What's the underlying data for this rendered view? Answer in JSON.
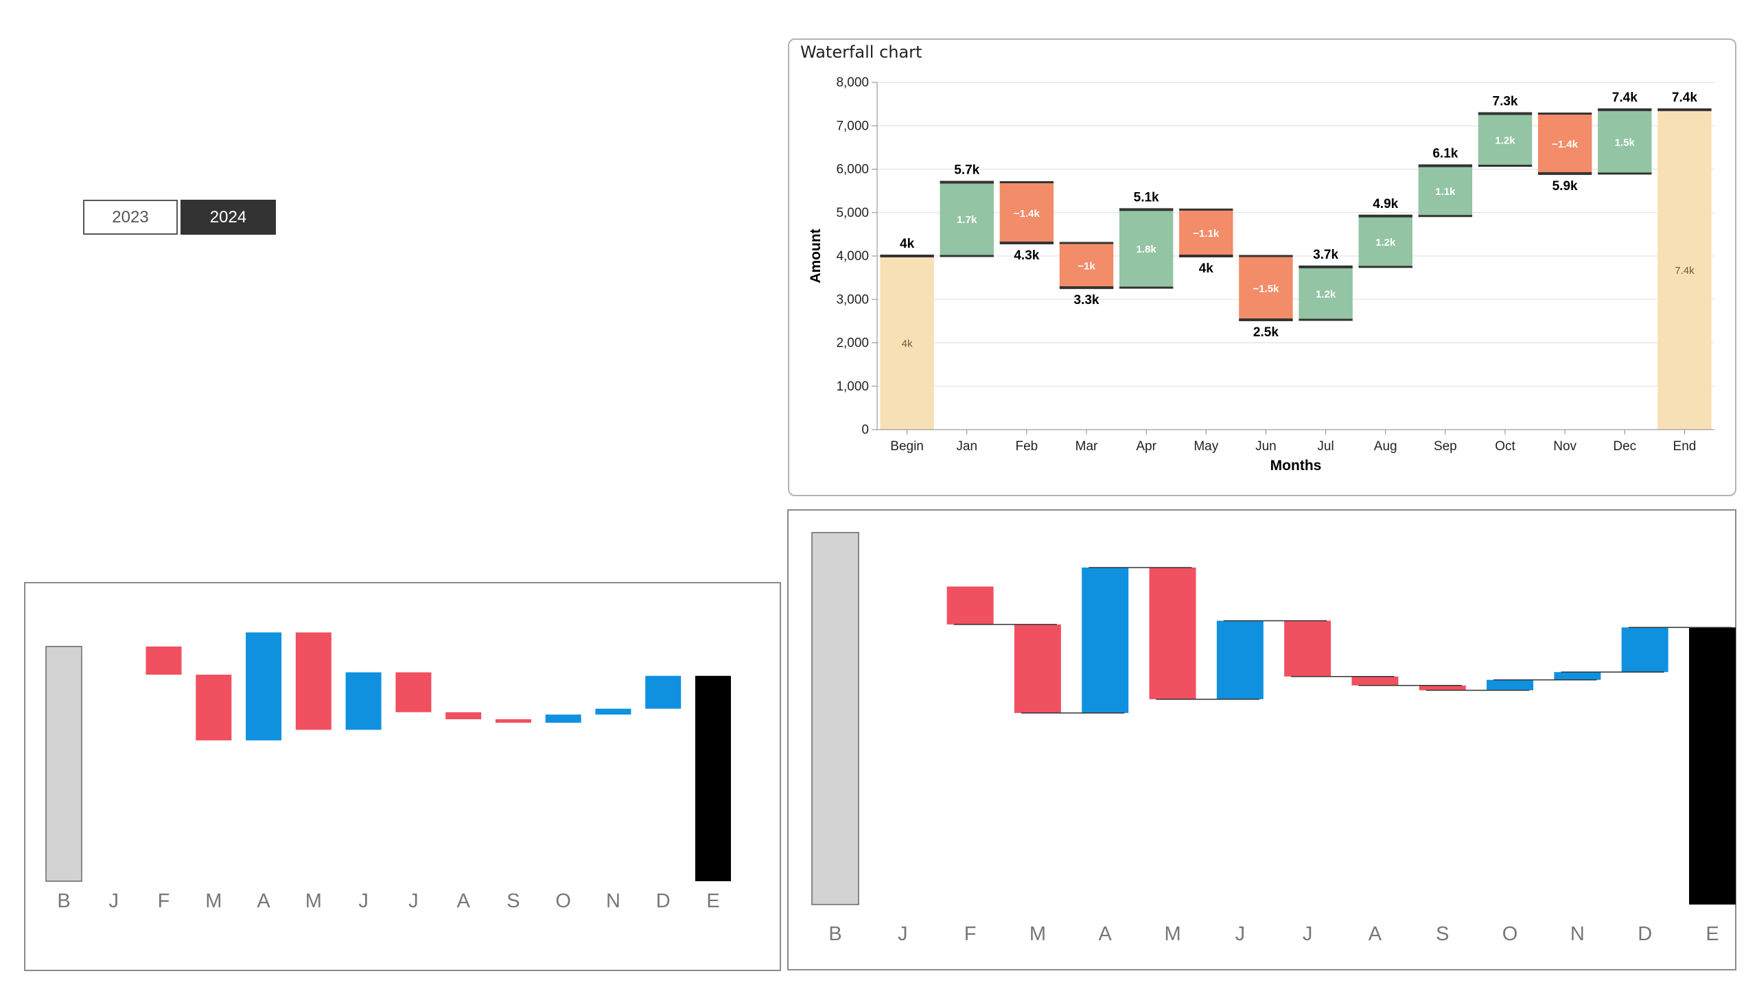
{
  "year_toggle": {
    "options": [
      "2023",
      "2024"
    ],
    "selected": "2024"
  },
  "chart_data": [
    {
      "type": "bar",
      "subtype": "waterfall",
      "title": "Waterfall chart",
      "xlabel": "Months",
      "ylabel": "Amount",
      "ylim": [
        0,
        8000
      ],
      "yticks": [
        "0",
        "1,000",
        "2,000",
        "3,000",
        "4,000",
        "5,000",
        "6,000",
        "7,000",
        "8,000"
      ],
      "grid": true,
      "categories": [
        "Begin",
        "Jan",
        "Feb",
        "Mar",
        "Apr",
        "May",
        "Jun",
        "Jul",
        "Aug",
        "Sep",
        "Oct",
        "Nov",
        "Dec",
        "End"
      ],
      "bars": [
        {
          "start": 0,
          "end": 4000,
          "kind": "total",
          "label": "4k",
          "total_label": "4k"
        },
        {
          "start": 4000,
          "end": 5700,
          "kind": "increase",
          "label": "1.7k",
          "total_label": "5.7k"
        },
        {
          "start": 5700,
          "end": 4300,
          "kind": "decrease",
          "label": "−1.4k",
          "total_label": "4.3k"
        },
        {
          "start": 4300,
          "end": 3270,
          "kind": "decrease",
          "label": "−1k",
          "total_label": "3.3k"
        },
        {
          "start": 3270,
          "end": 5070,
          "kind": "increase",
          "label": "1.8k",
          "total_label": "5.1k"
        },
        {
          "start": 5070,
          "end": 4000,
          "kind": "decrease",
          "label": "−1.1k",
          "total_label": "4k"
        },
        {
          "start": 4000,
          "end": 2530,
          "kind": "decrease",
          "label": "−1.5k",
          "total_label": "2.5k"
        },
        {
          "start": 2530,
          "end": 3750,
          "kind": "increase",
          "label": "1.2k",
          "total_label": "3.7k"
        },
        {
          "start": 3750,
          "end": 4920,
          "kind": "increase",
          "label": "1.2k",
          "total_label": "4.9k"
        },
        {
          "start": 4920,
          "end": 6080,
          "kind": "increase",
          "label": "1.1k",
          "total_label": "6.1k"
        },
        {
          "start": 6080,
          "end": 7280,
          "kind": "increase",
          "label": "1.2k",
          "total_label": "7.3k"
        },
        {
          "start": 7280,
          "end": 5900,
          "kind": "decrease",
          "label": "−1.4k",
          "total_label": "5.9k"
        },
        {
          "start": 5900,
          "end": 7370,
          "kind": "increase",
          "label": "1.5k",
          "total_label": "7.4k"
        },
        {
          "start": 0,
          "end": 7370,
          "kind": "total",
          "label": "7.4k",
          "total_label": "7.4k"
        }
      ],
      "colors": {
        "increase": "#93c4a4",
        "decrease": "#f28c69",
        "total": "#f8e0b6",
        "connector": "#333333"
      }
    },
    {
      "type": "bar",
      "subtype": "waterfall",
      "categories": [
        "B",
        "J",
        "F",
        "M",
        "A",
        "M",
        "J",
        "J",
        "A",
        "S",
        "O",
        "N",
        "D",
        "E"
      ],
      "axis_ticks": false,
      "bars": [
        {
          "start": 0,
          "end": 100,
          "kind": "total"
        },
        {
          "start": 100,
          "end": 100,
          "kind": "none"
        },
        {
          "start": 100,
          "end": 88,
          "kind": "decrease"
        },
        {
          "start": 88,
          "end": 60,
          "kind": "decrease"
        },
        {
          "start": 60,
          "end": 106,
          "kind": "increase"
        },
        {
          "start": 106,
          "end": 64.5,
          "kind": "decrease"
        },
        {
          "start": 64.5,
          "end": 89,
          "kind": "increase"
        },
        {
          "start": 89,
          "end": 72,
          "kind": "decrease"
        },
        {
          "start": 72,
          "end": 69,
          "kind": "decrease"
        },
        {
          "start": 69,
          "end": 67.5,
          "kind": "decrease"
        },
        {
          "start": 67.5,
          "end": 71,
          "kind": "increase"
        },
        {
          "start": 71,
          "end": 73.5,
          "kind": "increase"
        },
        {
          "start": 73.5,
          "end": 87.5,
          "kind": "increase"
        },
        {
          "start": 0,
          "end": 87.5,
          "kind": "grand_total"
        }
      ],
      "colors": {
        "increase": "#0f91e0",
        "decrease": "#f05060",
        "total": "#d3d3d3",
        "grand_total": "#000000"
      }
    },
    {
      "type": "bar",
      "subtype": "waterfall",
      "categories": [
        "B",
        "J",
        "F",
        "M",
        "A",
        "M",
        "J",
        "J",
        "A",
        "S",
        "O",
        "N",
        "D",
        "E"
      ],
      "axis_ticks": false,
      "connectors": true,
      "bars": [
        {
          "start": 0,
          "end": 100,
          "kind": "total"
        },
        {
          "start": 100,
          "end": 100,
          "kind": "none"
        },
        {
          "start": 85.5,
          "end": 75.3,
          "kind": "decrease"
        },
        {
          "start": 75.3,
          "end": 51.5,
          "kind": "decrease"
        },
        {
          "start": 51.5,
          "end": 90.6,
          "kind": "increase"
        },
        {
          "start": 90.6,
          "end": 55.2,
          "kind": "decrease"
        },
        {
          "start": 55.2,
          "end": 76.3,
          "kind": "increase"
        },
        {
          "start": 76.3,
          "end": 61.3,
          "kind": "decrease"
        },
        {
          "start": 61.3,
          "end": 58.9,
          "kind": "decrease"
        },
        {
          "start": 58.9,
          "end": 57.6,
          "kind": "decrease"
        },
        {
          "start": 57.6,
          "end": 60.4,
          "kind": "increase"
        },
        {
          "start": 60.4,
          "end": 62.5,
          "kind": "increase"
        },
        {
          "start": 62.5,
          "end": 74.5,
          "kind": "increase"
        },
        {
          "start": 0,
          "end": 74.5,
          "kind": "grand_total"
        }
      ],
      "colors": {
        "increase": "#0f91e0",
        "decrease": "#f05060",
        "total": "#d3d3d3",
        "grand_total": "#000000",
        "connector": "#333333"
      }
    }
  ]
}
